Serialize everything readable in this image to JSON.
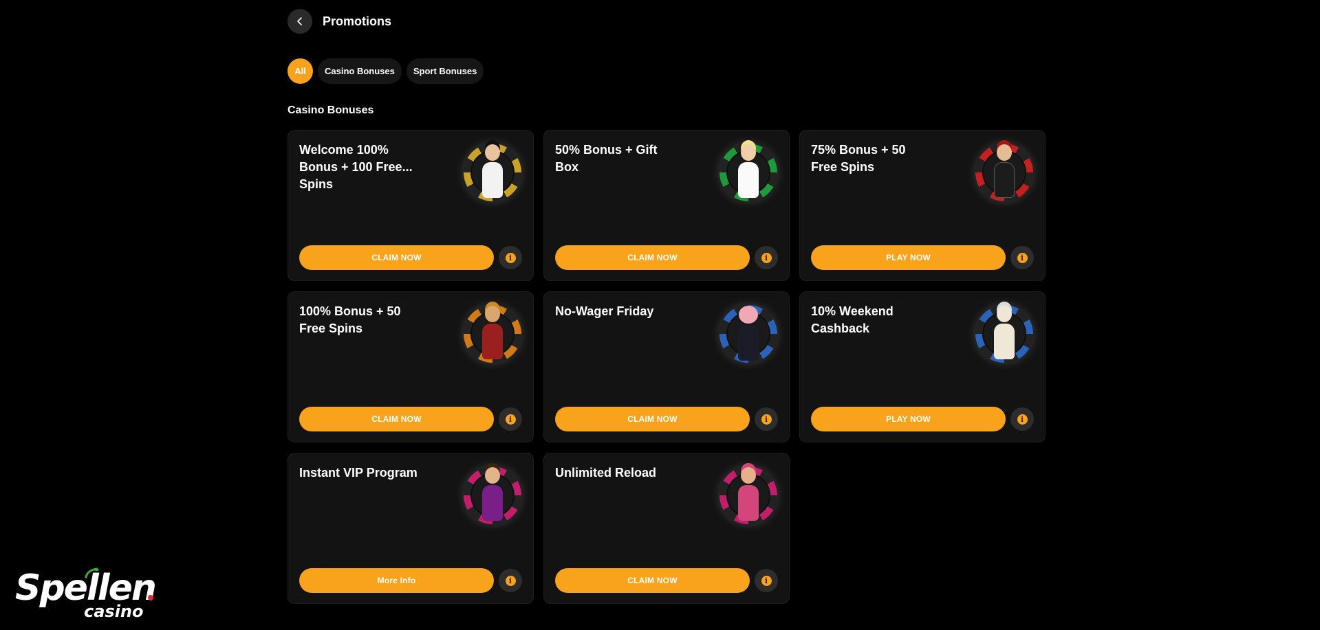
{
  "header": {
    "back_icon": "chevron-left-icon",
    "title": "Promotions"
  },
  "filters": [
    {
      "label": "All",
      "active": true
    },
    {
      "label": "Casino Bonuses",
      "active": false
    },
    {
      "label": "Sport Bonuses",
      "active": false
    }
  ],
  "section": {
    "title": "Casino Bonuses"
  },
  "cards": [
    {
      "title": "Welcome 100% Bonus + 100 Free...\nSpins",
      "cta": "CLAIM NOW",
      "art": "elvis-character",
      "ring": "#c9a227"
    },
    {
      "title": "50% Bonus + Gift Box",
      "cta": "CLAIM NOW",
      "art": "marilyn-character",
      "ring": "#1f9a3a"
    },
    {
      "title": "75% Bonus + 50 Free Spins",
      "cta": "PLAY NOW",
      "art": "sinatra-character",
      "ring": "#c42020"
    },
    {
      "title": "100% Bonus + 50 Free Spins",
      "cta": "CLAIM NOW",
      "art": "gladiator-character",
      "ring": "#d07a18"
    },
    {
      "title": "No-Wager Friday",
      "cta": "CLAIM NOW",
      "art": "pig-character",
      "ring": "#2a63b8"
    },
    {
      "title": "10% Weekend Cashback",
      "cta": "PLAY NOW",
      "art": "zeus-character",
      "ring": "#2a63b8"
    },
    {
      "title": "Instant VIP Program",
      "cta": "More Info",
      "art": "king-character",
      "ring": "#c21f6a"
    },
    {
      "title": "Unlimited Reload",
      "cta": "CLAIM NOW",
      "art": "cowgirl-character",
      "ring": "#c21f6a"
    }
  ],
  "logo": {
    "main": "Spellen",
    "sub": "casino"
  },
  "colors": {
    "accent": "#f9a21b",
    "card_bg": "#131313",
    "page_bg": "#000000"
  }
}
